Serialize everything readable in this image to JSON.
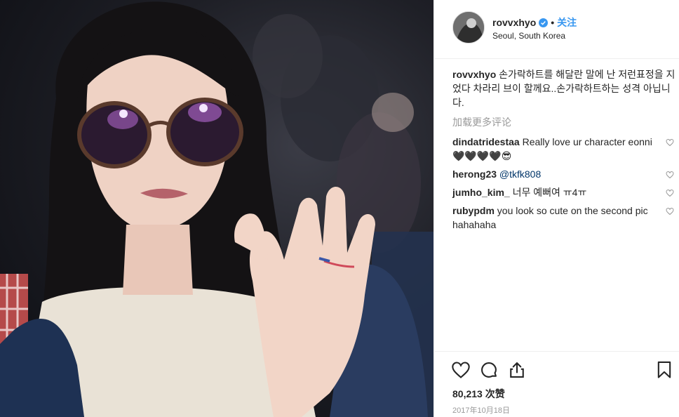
{
  "header": {
    "username": "rovvxhyo",
    "separator": "•",
    "follow_label": "关注",
    "location": "Seoul, South Korea"
  },
  "caption": {
    "username": "rovvxhyo",
    "text": "손가락하트를 해달란 말에 난 저런표정을 지었다 차라리 브이 할께요..손가락하트하는 성격 아닙니다."
  },
  "load_more_label": "加载更多评论",
  "comments": [
    {
      "username": "dindatridestaa",
      "text": "Really love ur character eonni 🖤🖤🖤🖤😎"
    },
    {
      "username": "herong23",
      "mention": "@tkfk808"
    },
    {
      "username": "jumho_kim_",
      "text": "너무 예뻐여 ㅠ4ㅠ"
    },
    {
      "username": "rubypdm",
      "text": "you look so cute on the second pic hahahaha"
    }
  ],
  "likes": {
    "count": "80,213",
    "label": "次赞"
  },
  "date": "2017年10月18日",
  "icons": [
    "verified-badge-icon",
    "heart-icon",
    "comment-icon",
    "share-icon",
    "bookmark-icon"
  ],
  "colors": {
    "accent": "#3897f0",
    "mention": "#003569",
    "muted": "#999999",
    "text": "#262626"
  }
}
